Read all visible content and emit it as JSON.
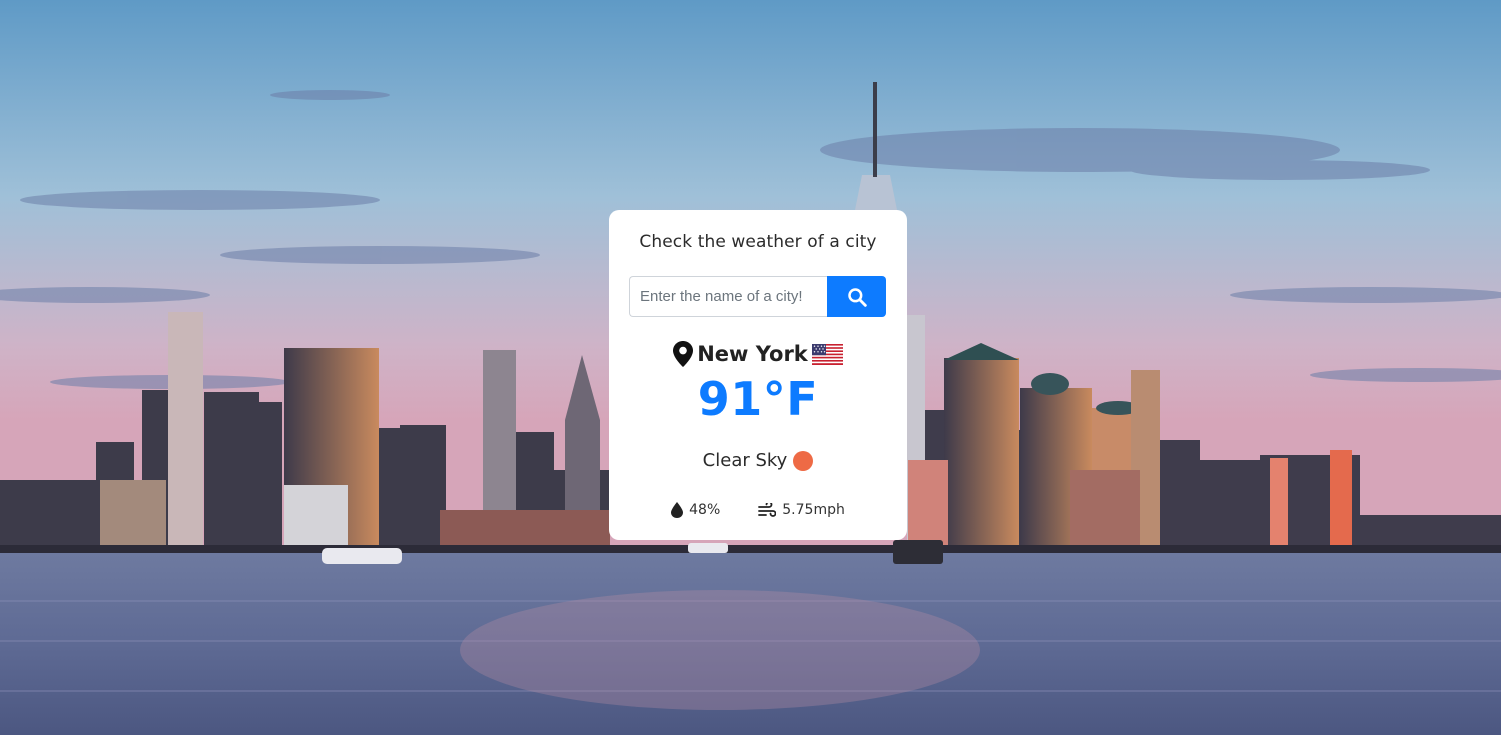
{
  "card": {
    "title": "Check the weather of a city",
    "search": {
      "placeholder": "Enter the name of a city!",
      "value": "",
      "button_icon": "search-icon"
    },
    "location": {
      "icon": "map-pin-icon",
      "city": "New York",
      "flag": "us-flag-icon"
    },
    "temperature": "91°F",
    "condition": {
      "text": "Clear Sky",
      "icon": "sun-icon"
    },
    "stats": {
      "humidity": {
        "icon": "droplet-icon",
        "value": "48%"
      },
      "wind": {
        "icon": "wind-icon",
        "value": "5.75mph"
      }
    }
  },
  "colors": {
    "accent": "#0d7bff",
    "card_bg": "#ffffff",
    "sun": "#ee6a45",
    "sky_top": "#7aa9cf",
    "sky_bottom": "#d9a3b8",
    "water": "#5f6e96"
  },
  "background": {
    "icon": "city-skyline-background"
  }
}
